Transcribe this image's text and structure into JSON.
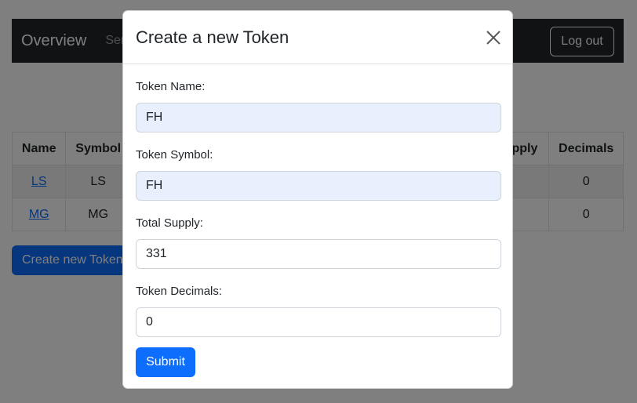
{
  "navbar": {
    "brand": "Overview",
    "nav_link": "Send",
    "logout_label": "Log out"
  },
  "table": {
    "headers": [
      "Name",
      "Symbol",
      "",
      "",
      "Supply",
      "Decimals"
    ],
    "rows": [
      {
        "name": "LS",
        "symbol": "LS",
        "decimals": "0"
      },
      {
        "name": "MG",
        "symbol": "MG",
        "decimals": "0"
      }
    ]
  },
  "create_button_label": "Create new Token",
  "modal": {
    "title": "Create a new Token",
    "fields": [
      {
        "label": "Token Name:",
        "value": "FH"
      },
      {
        "label": "Token Symbol:",
        "value": "FH"
      },
      {
        "label": "Total Supply:",
        "value": "331"
      },
      {
        "label": "Token Decimals:",
        "value": "0"
      }
    ],
    "submit_label": "Submit"
  },
  "colors": {
    "primary": "#0d6efd",
    "navbar": "#212529",
    "autofill": "#e8f0fe"
  }
}
